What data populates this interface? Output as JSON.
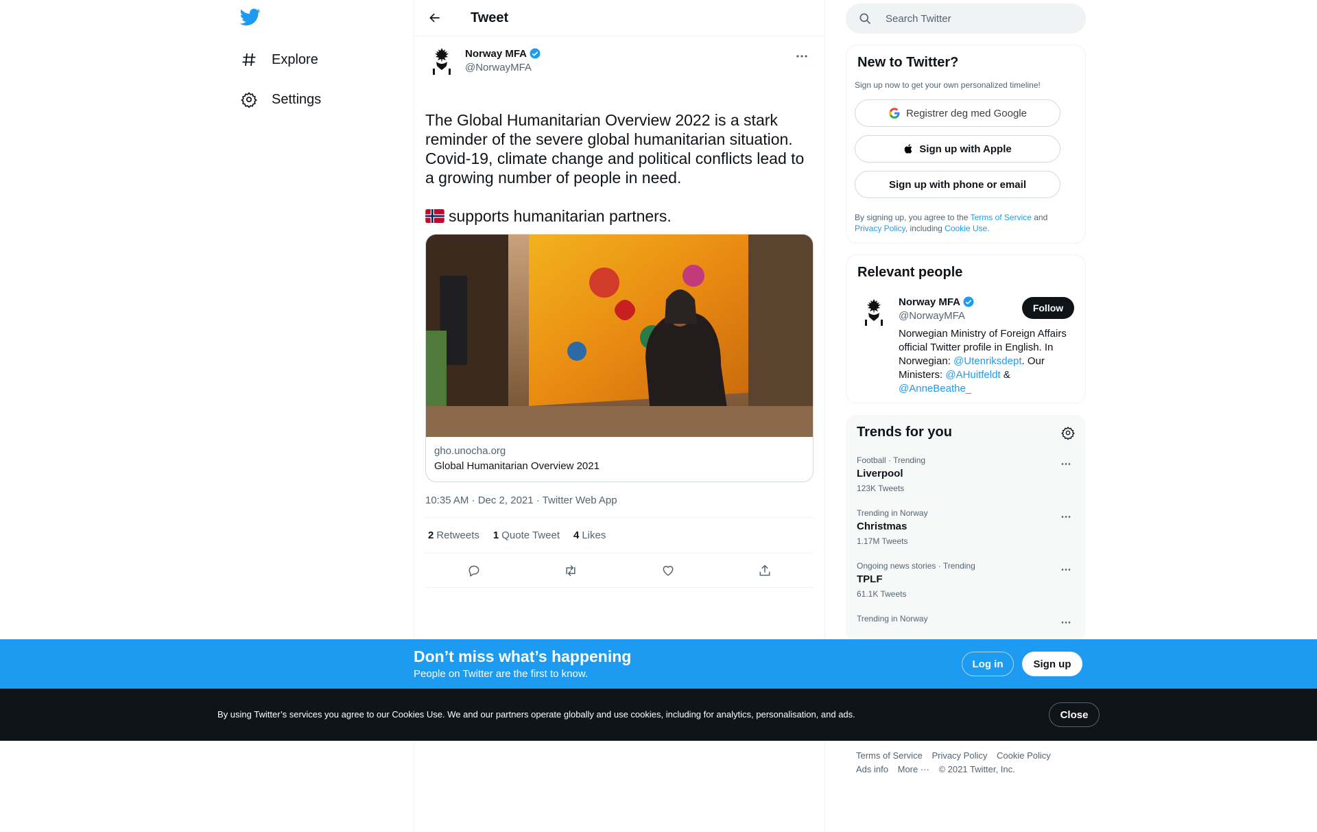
{
  "nav": {
    "logo": "twitter-bird-icon",
    "items": [
      {
        "label": "Explore",
        "icon": "hashtag-icon"
      },
      {
        "label": "Settings",
        "icon": "gear-icon"
      }
    ]
  },
  "header": {
    "title": "Tweet",
    "back_icon": "arrow-left-icon"
  },
  "tweet": {
    "author_name": "Norway MFA",
    "author_handle": "@NorwayMFA",
    "text_main": "The Global Humanitarian Overview 2022 is a stark reminder of the severe global humanitarian situation. Covid-19, climate change and political conflicts lead to a growing number of people in need.",
    "text_flag_line": "supports humanitarian partners.",
    "card": {
      "domain": "gho.unocha.org",
      "title": "Global Humanitarian Overview 2021"
    },
    "timestamp": "10:35 AM · Dec 2, 2021 · Twitter Web App",
    "stats": [
      {
        "count": "2",
        "label": "Retweets"
      },
      {
        "count": "1",
        "label": "Quote Tweet"
      },
      {
        "count": "4",
        "label": "Likes"
      }
    ]
  },
  "search": {
    "placeholder": "Search Twitter"
  },
  "new_to_twitter": {
    "title": "New to Twitter?",
    "subtitle": "Sign up now to get your own personalized timeline!",
    "google_label": "Registrer deg med Google",
    "apple_label": "Sign up with Apple",
    "phone_label": "Sign up with phone or email",
    "legal_1": "By signing up, you agree to the ",
    "legal_tos": "Terms of Service",
    "legal_and": " and ",
    "legal_privacy": "Privacy Policy",
    "legal_including": ", including ",
    "legal_cookie": "Cookie Use."
  },
  "relevant_people": {
    "title": "Relevant people",
    "name": "Norway MFA",
    "handle": "@NorwayMFA",
    "follow_label": "Follow",
    "bio_1": "Norwegian Ministry of Foreign Affairs official Twitter profile in English. In Norwegian: ",
    "bio_link1": "@Utenriksdept",
    "bio_2": ". Our Ministers: ",
    "bio_link2": "@AHuitfeldt",
    "bio_3": " & ",
    "bio_link3": "@AnneBeathe_"
  },
  "trends": {
    "title": "Trends for you",
    "items": [
      {
        "category": "Football · Trending",
        "name": "Liverpool",
        "count": "123K Tweets"
      },
      {
        "category": "Trending in Norway",
        "name": "Christmas",
        "count": "1.17M Tweets"
      },
      {
        "category": "Ongoing news stories · Trending",
        "name": "TPLF",
        "count": "61.1K Tweets"
      },
      {
        "category": "Trending in Norway",
        "name": "",
        "count": ""
      }
    ]
  },
  "footer": {
    "links": [
      "Terms of Service",
      "Privacy Policy",
      "Cookie Policy",
      "Ads info",
      "More ···"
    ],
    "copyright": "© 2021 Twitter, Inc."
  },
  "signup_bar": {
    "heading": "Don’t miss what’s happening",
    "subheading": "People on Twitter are the first to know.",
    "login_label": "Log in",
    "signup_label": "Sign up"
  },
  "cookie_bar": {
    "text": "By using Twitter’s services you agree to our Cookies Use. We and our partners operate globally and use cookies, including for analytics, personalisation, and ads.",
    "close_label": "Close"
  },
  "colors": {
    "accent": "#1d9bf0",
    "text": "#0f1419",
    "muted": "#536471",
    "dark_bar": "#0f1419"
  }
}
